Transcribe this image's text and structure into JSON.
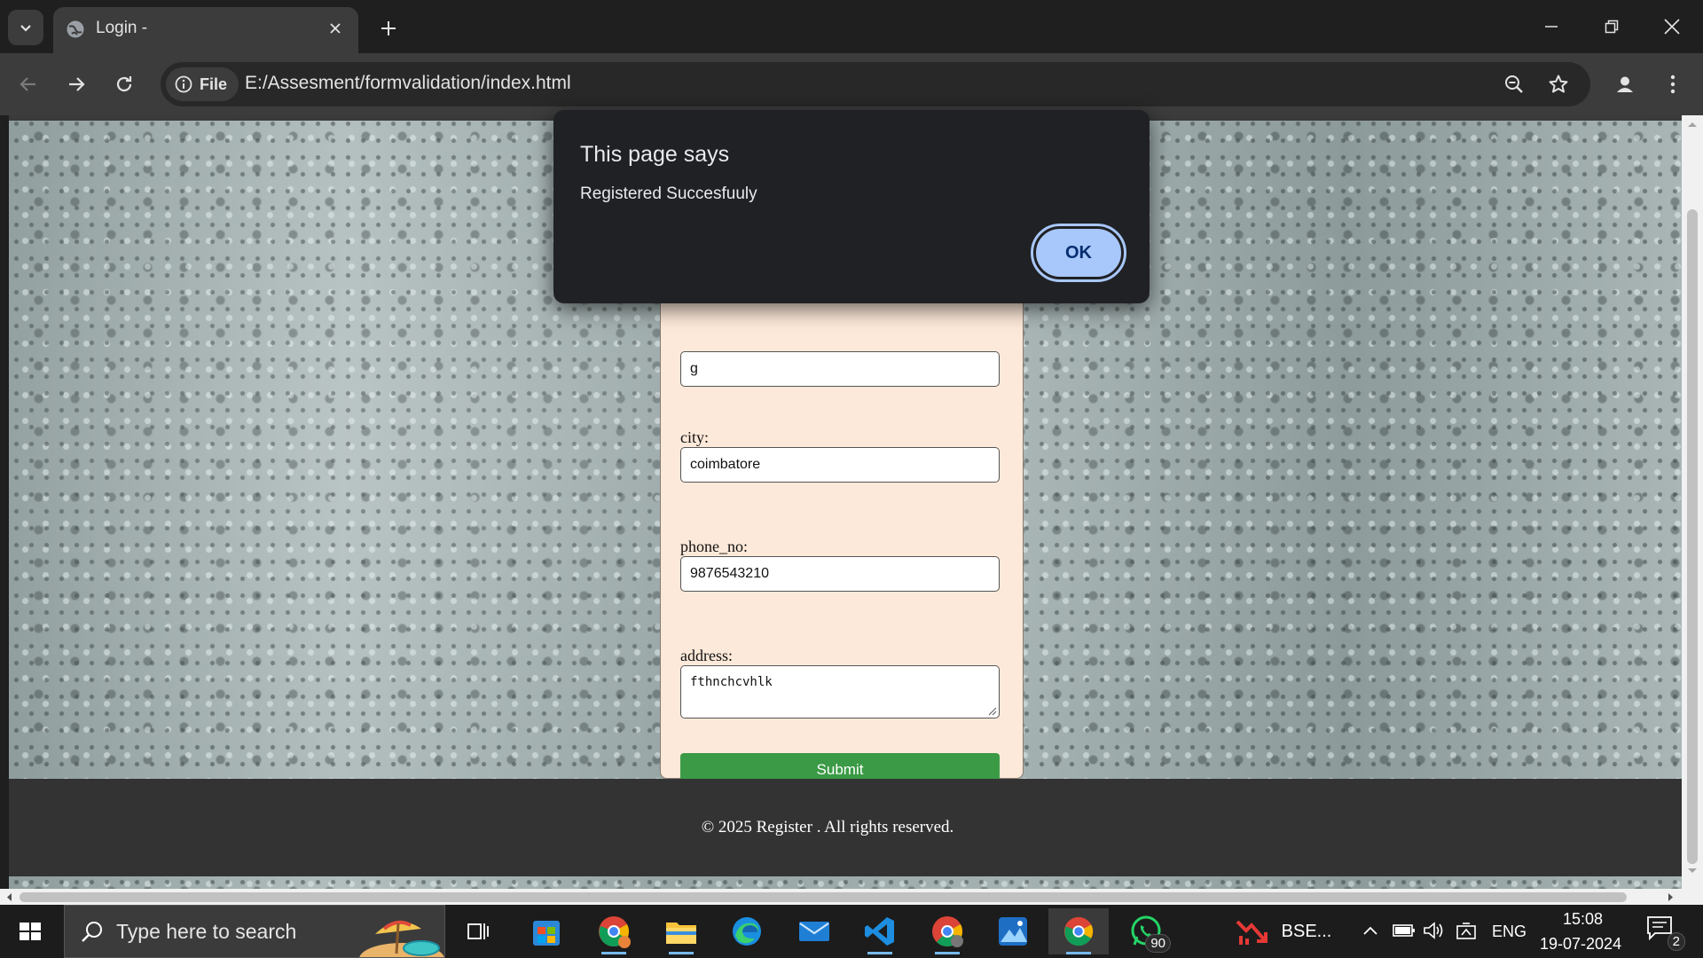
{
  "browser": {
    "tab_title": "Login -",
    "url_chip": "File",
    "url": "E:/Assesment/formvalidation/index.html"
  },
  "form": {
    "partial_value": "g",
    "city_label": "city:",
    "city_value": "coimbatore",
    "phone_label": "phone_no:",
    "phone_value": "9876543210",
    "address_label": "address:",
    "address_value": "fthnchcvhlk",
    "submit_label": "Submit"
  },
  "footer": {
    "text": "© 2025 Register . All rights reserved."
  },
  "dialog": {
    "title": "This page says",
    "message": "Registered Succesfuuly",
    "ok_label": "OK"
  },
  "taskbar": {
    "search_placeholder": "Type here to search",
    "bse_label": "BSE...",
    "whatsapp_badge": "90",
    "language": "ENG",
    "time": "15:08",
    "date": "19-07-2024",
    "notification_count": "2"
  },
  "colors": {
    "submit_green": "#3a9a45",
    "dialog_ok_blue": "#a8c7fa",
    "form_bg": "#fde9d9"
  }
}
